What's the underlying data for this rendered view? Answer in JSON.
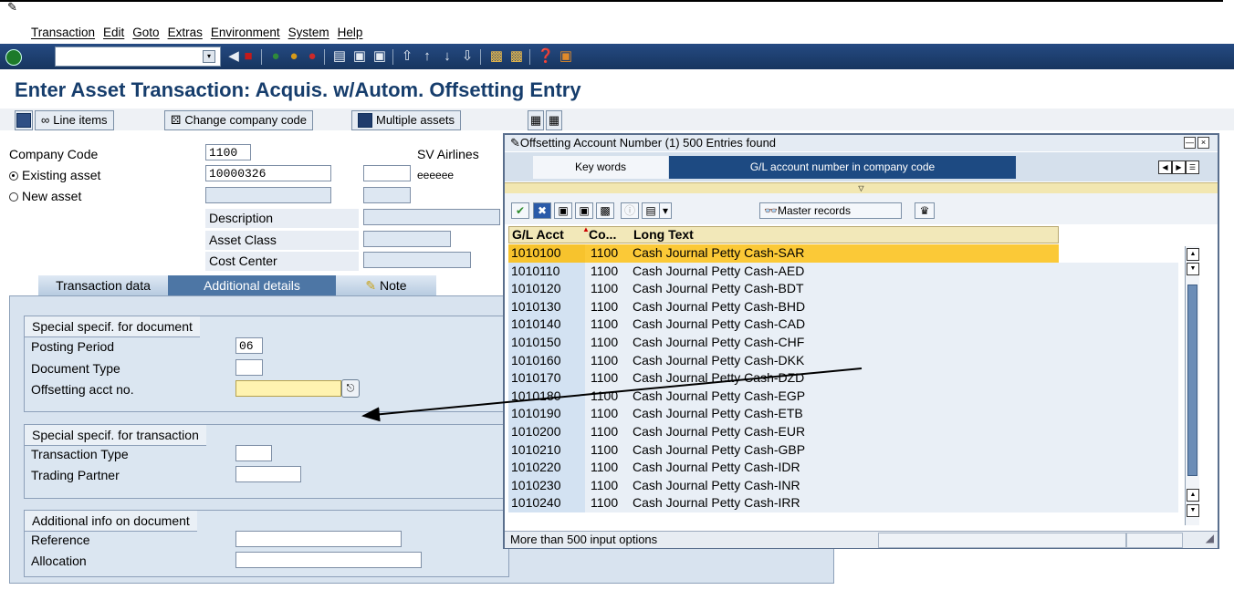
{
  "menu": [
    "Transaction",
    "Edit",
    "Goto",
    "Extras",
    "Environment",
    "System",
    "Help"
  ],
  "title": "Enter Asset Transaction: Acquis. w/Autom. Offsetting Entry",
  "app_toolbar": {
    "line_items": "Line items",
    "change_company": "Change company code",
    "multiple_assets": "Multiple assets"
  },
  "header": {
    "company_code_label": "Company Code",
    "company_code_value": "1100",
    "company_name": "SV Airlines",
    "existing_asset_label": "Existing asset",
    "existing_asset_value": "10000326",
    "existing_asset_text": "eeeeee",
    "new_asset_label": "New asset",
    "description_label": "Description",
    "asset_class_label": "Asset Class",
    "cost_center_label": "Cost Center"
  },
  "tabs": [
    "Transaction data",
    "Additional details",
    "Note"
  ],
  "groups": {
    "doc": {
      "title": "Special specif. for document",
      "posting_period_label": "Posting Period",
      "posting_period_value": "06",
      "document_type_label": "Document Type",
      "offsetting_label": "Offsetting acct no."
    },
    "trans": {
      "title": "Special specif. for transaction",
      "transaction_type_label": "Transaction Type",
      "trading_partner_label": "Trading Partner"
    },
    "info": {
      "title": "Additional info on document",
      "reference_label": "Reference",
      "allocation_label": "Allocation"
    }
  },
  "popup": {
    "title": "Offsetting Account Number (1)  500 Entries found",
    "tab_keywords": "Key words",
    "tab_gl": "G/L account number in company code",
    "master_records": "Master records",
    "columns": [
      "G/L Acct",
      "Co...",
      "Long Text"
    ],
    "rows": [
      {
        "acct": "1010100",
        "co": "1100",
        "text": "Cash Journal Petty Cash-SAR"
      },
      {
        "acct": "1010110",
        "co": "1100",
        "text": "Cash Journal Petty Cash-AED"
      },
      {
        "acct": "1010120",
        "co": "1100",
        "text": "Cash Journal Petty Cash-BDT"
      },
      {
        "acct": "1010130",
        "co": "1100",
        "text": "Cash Journal Petty Cash-BHD"
      },
      {
        "acct": "1010140",
        "co": "1100",
        "text": "Cash Journal Petty Cash-CAD"
      },
      {
        "acct": "1010150",
        "co": "1100",
        "text": "Cash Journal Petty Cash-CHF"
      },
      {
        "acct": "1010160",
        "co": "1100",
        "text": "Cash Journal Petty Cash-DKK"
      },
      {
        "acct": "1010170",
        "co": "1100",
        "text": "Cash Journal Petty Cash-DZD"
      },
      {
        "acct": "1010180",
        "co": "1100",
        "text": "Cash Journal Petty Cash-EGP"
      },
      {
        "acct": "1010190",
        "co": "1100",
        "text": "Cash Journal Petty Cash-ETB"
      },
      {
        "acct": "1010200",
        "co": "1100",
        "text": "Cash Journal Petty Cash-EUR"
      },
      {
        "acct": "1010210",
        "co": "1100",
        "text": "Cash Journal Petty Cash-GBP"
      },
      {
        "acct": "1010220",
        "co": "1100",
        "text": "Cash Journal Petty Cash-IDR"
      },
      {
        "acct": "1010230",
        "co": "1100",
        "text": "Cash Journal Petty Cash-INR"
      },
      {
        "acct": "1010240",
        "co": "1100",
        "text": "Cash Journal Petty Cash-IRR"
      }
    ],
    "status": "More than  500 input options"
  },
  "colors": {
    "title": "#163d6c",
    "toolbar": "#1f4477",
    "selected_row": "#fbc937",
    "required_field": "#fff3b0"
  }
}
